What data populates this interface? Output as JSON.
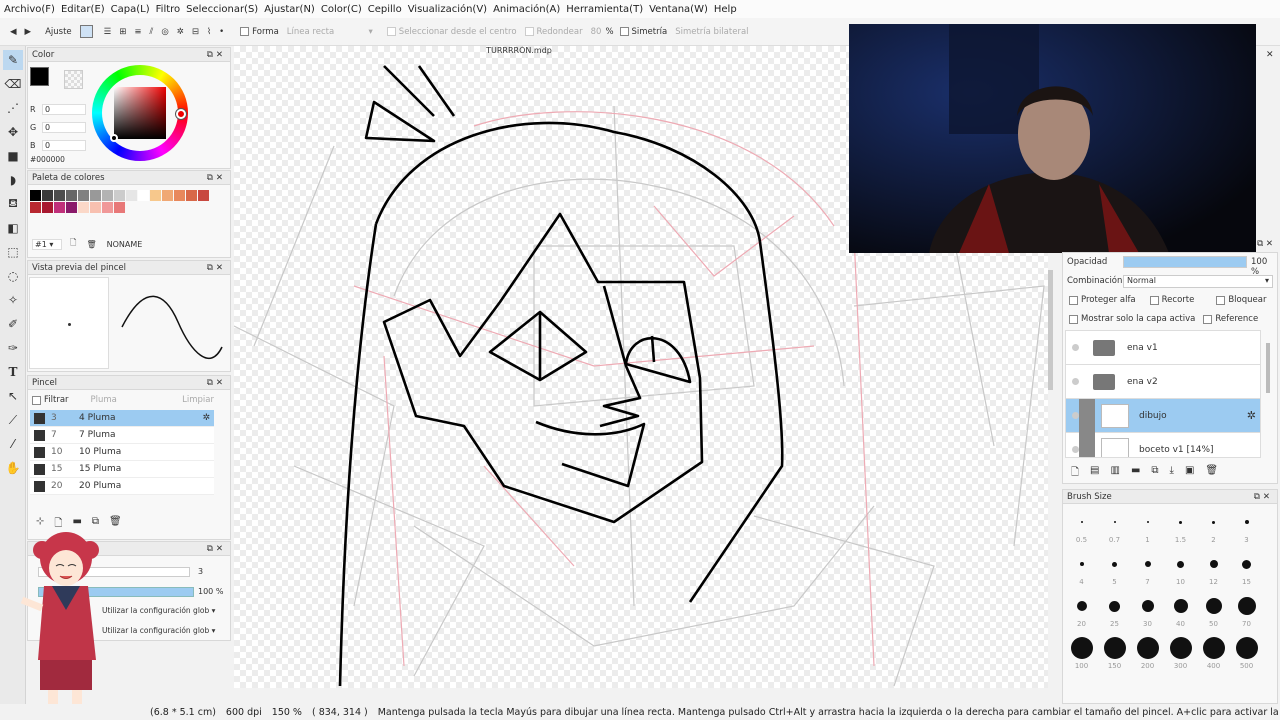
{
  "menu": [
    "Archivo(F)",
    "Editar(E)",
    "Capa(L)",
    "Filtro",
    "Seleccionar(S)",
    "Ajustar(N)",
    "Color(C)",
    "Cepillo",
    "Visualización(V)",
    "Animación(A)",
    "Herramienta(T)",
    "Ventana(W)",
    "Help"
  ],
  "toolbar": {
    "adjust_label": "Ajuste",
    "shape_label": "Forma",
    "shape_value": "Línea recta",
    "select_center_label": "Seleccionar desde el centro",
    "round_label": "Redondear",
    "round_value": "80",
    "round_unit": "%",
    "symmetry_label": "Simetría",
    "symmetry_value": "Simetría bilateral"
  },
  "document_tab": "TURRRRÓN.mdp",
  "color_panel": {
    "title": "Color",
    "r_label": "R",
    "r_value": "0",
    "g_label": "G",
    "g_value": "0",
    "b_label": "B",
    "b_value": "0",
    "hex": "#000000",
    "current_color": "#000000"
  },
  "palette_panel": {
    "title": "Paleta de colores",
    "page": "#1",
    "palette_name": "NONAME",
    "colors": [
      "#000000",
      "#3a3a3a",
      "#4d4d4d",
      "#666666",
      "#808080",
      "#999999",
      "#b3b3b3",
      "#cccccc",
      "#e6e6e6",
      "#ffffff",
      "#f7c88c",
      "#f0a874",
      "#e8885c",
      "#d86848",
      "#c84840",
      "#b82830",
      "#a81830",
      "#c0307a",
      "#8a1a6a",
      "#fbd8c8",
      "#f8c0b0",
      "#f09898",
      "#e87878"
    ]
  },
  "brush_preview_panel": {
    "title": "Vista previa del pincel"
  },
  "brush_panel": {
    "title": "Pincel",
    "filter_label": "Filtrar",
    "filter_value": "Pluma",
    "clear_label": "Limpiar",
    "items": [
      {
        "num": "3",
        "name": "4 Pluma",
        "selected": true
      },
      {
        "num": "7",
        "name": "7 Pluma",
        "selected": false
      },
      {
        "num": "10",
        "name": "10 Pluma",
        "selected": false
      },
      {
        "num": "15",
        "name": "15 Pluma",
        "selected": false
      },
      {
        "num": "20",
        "name": "20 Pluma",
        "selected": false
      }
    ]
  },
  "brush_control_panel": {
    "size_value": "3",
    "opacity_value": "100 %",
    "setting1": "Utilizar la configuración glob",
    "setting2": "Utilizar la configuración glob"
  },
  "layer_panel": {
    "opacity_label": "Opacidad",
    "opacity_value": "100 %",
    "opacity_level": 1.0,
    "blend_label": "Combinación",
    "blend_value": "Normal",
    "protect_alpha": "Proteger alfa",
    "clipping": "Recorte",
    "lock": "Bloquear",
    "show_active_only": "Mostrar solo la capa activa",
    "reference": "Reference",
    "layers": [
      {
        "name": "ena v1",
        "type": "folder",
        "selected": false
      },
      {
        "name": "ena v2",
        "type": "folder",
        "selected": false
      },
      {
        "name": "dibujo",
        "type": "layer",
        "selected": true
      },
      {
        "name": "boceto v1 [14%]",
        "type": "layer",
        "selected": false
      }
    ]
  },
  "brush_size_panel": {
    "title": "Brush Size",
    "sizes": [
      "0.5",
      "0.7",
      "1",
      "1.5",
      "2",
      "3",
      "4",
      "5",
      "7",
      "10",
      "12",
      "15",
      "20",
      "25",
      "30",
      "40",
      "50",
      "70",
      "100",
      "150",
      "200",
      "300",
      "400",
      "500"
    ]
  },
  "status_bar": {
    "dims": "(6.8 * 5.1 cm)",
    "dpi": "600 dpi",
    "zoom": "150 %",
    "coords": "( 834, 314 )",
    "hint": "Mantenga pulsada la tecla Mayús para dibujar una línea recta. Mantenga pulsado Ctrl+Alt y arrastra hacia la izquierda o la derecha para cambiar el tamaño del pincel. A+clic para activar la capa."
  }
}
